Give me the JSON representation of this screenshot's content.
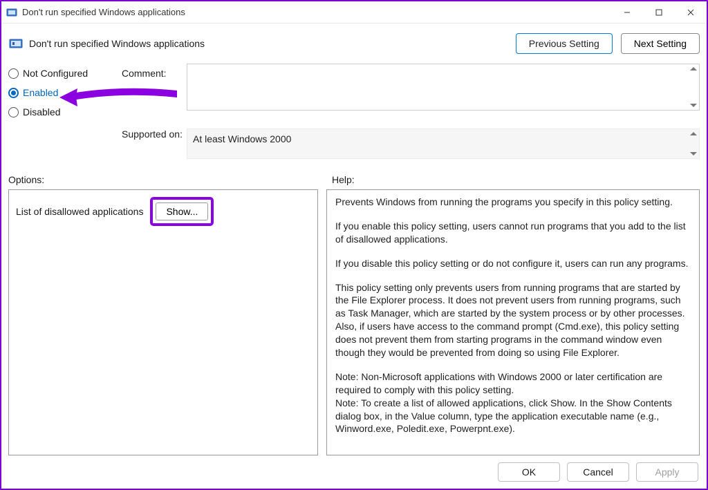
{
  "window": {
    "title": "Don't run specified Windows applications"
  },
  "header": {
    "policy_title": "Don't run specified Windows applications",
    "prev_label": "Previous Setting",
    "next_label": "Next Setting"
  },
  "config": {
    "not_configured_label": "Not Configured",
    "enabled_label": "Enabled",
    "disabled_label": "Disabled",
    "selected": "enabled",
    "comment_label": "Comment:",
    "comment_value": "",
    "supported_label": "Supported on:",
    "supported_value": "At least Windows 2000"
  },
  "labels": {
    "options": "Options:",
    "help": "Help:"
  },
  "options": {
    "disallowed_label": "List of disallowed applications",
    "show_label": "Show..."
  },
  "help": {
    "p1": "Prevents Windows from running the programs you specify in this policy setting.",
    "p2": "If you enable this policy setting, users cannot run programs that you add to the list of disallowed applications.",
    "p3": "If you disable this policy setting or do not configure it, users can run any programs.",
    "p4": "This policy setting only prevents users from running programs that are started by the File Explorer process. It does not prevent users from running programs, such as Task Manager, which are started by the system process or by other processes.  Also, if users have access to the command prompt (Cmd.exe), this policy setting does not prevent them from starting programs in the command window even though they would be prevented from doing so using File Explorer.",
    "p5": "Note: Non-Microsoft applications with Windows 2000 or later certification are required to comply with this policy setting.",
    "p6": "Note: To create a list of allowed applications, click Show.  In the Show Contents dialog box, in the Value column, type the application executable name (e.g., Winword.exe, Poledit.exe, Powerpnt.exe)."
  },
  "footer": {
    "ok": "OK",
    "cancel": "Cancel",
    "apply": "Apply"
  },
  "annotations": {
    "arrow_color": "#8a00e0",
    "show_highlight_color": "#8a00e0"
  }
}
